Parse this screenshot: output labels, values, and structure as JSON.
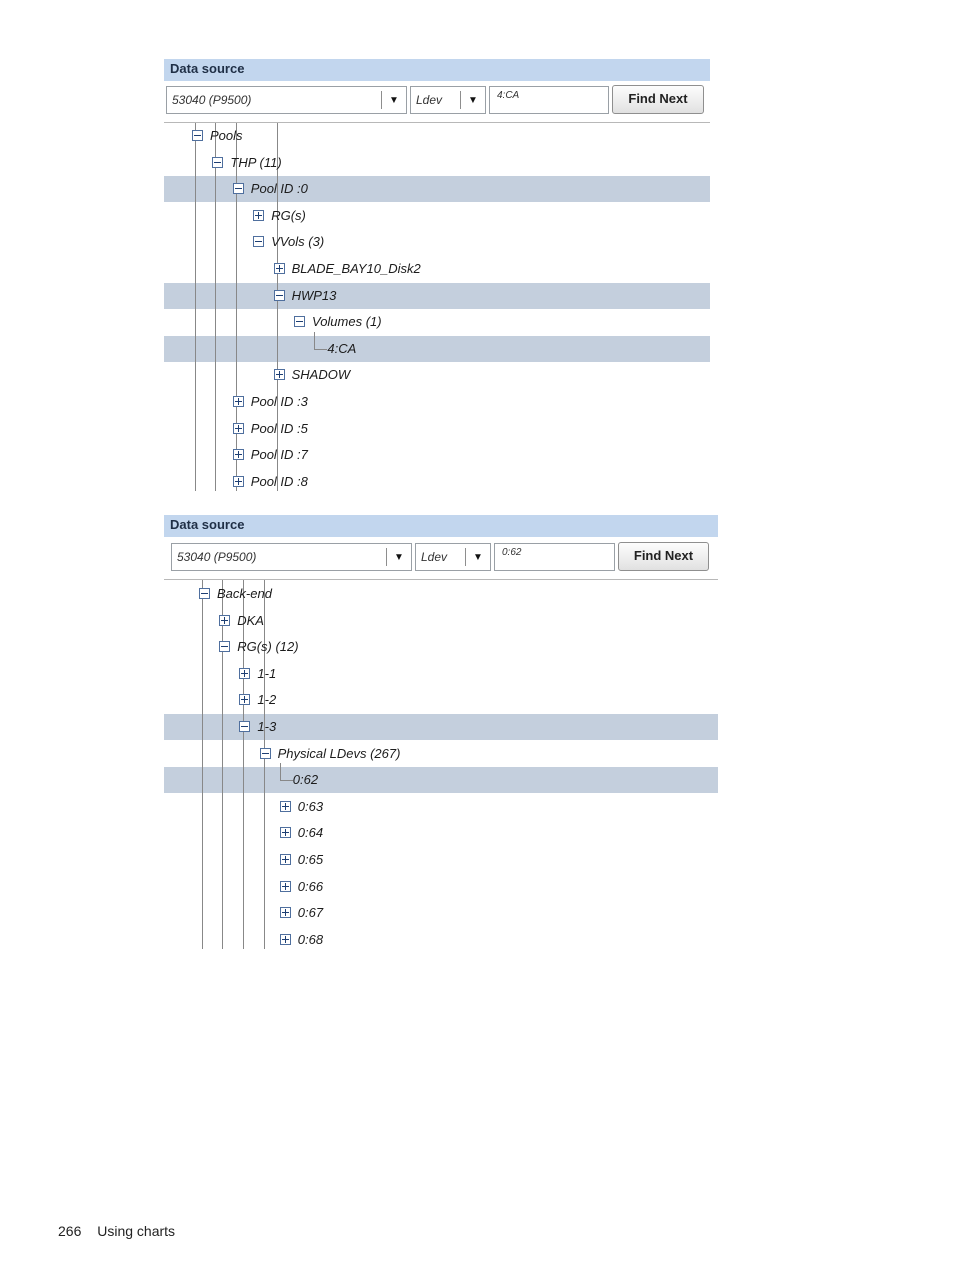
{
  "panels": [
    {
      "header": "Data source",
      "source_value": "53040  (P9500)",
      "type_value": "Ldev",
      "search_value": "4:CA",
      "find_next_label": "Find Next",
      "tree": [
        {
          "label": "Pools",
          "toggle": "minus",
          "depth": 0
        },
        {
          "label": "THP (11)",
          "toggle": "minus",
          "depth": 1
        },
        {
          "label": "Pool ID :0",
          "toggle": "minus",
          "depth": 2,
          "selected": true
        },
        {
          "label": "RG(s)",
          "toggle": "plus",
          "depth": 3
        },
        {
          "label": "VVols (3)",
          "toggle": "minus",
          "depth": 3
        },
        {
          "label": "BLADE_BAY10_Disk2",
          "toggle": "plus",
          "depth": 4
        },
        {
          "label": "HWP13",
          "toggle": "minus",
          "depth": 4,
          "selected": true
        },
        {
          "label": "Volumes (1)",
          "toggle": "minus",
          "depth": 5
        },
        {
          "label": "4:CA",
          "toggle": "leaf",
          "depth": 6,
          "selected": true
        },
        {
          "label": "SHADOW",
          "toggle": "plus",
          "depth": 4
        },
        {
          "label": "Pool ID :3",
          "toggle": "plus",
          "depth": 2
        },
        {
          "label": "Pool ID :5",
          "toggle": "plus",
          "depth": 2
        },
        {
          "label": "Pool ID :7",
          "toggle": "plus",
          "depth": 2
        },
        {
          "label": "Pool ID :8",
          "toggle": "plus",
          "depth": 2
        }
      ]
    },
    {
      "header": "Data source",
      "source_value": "53040  (P9500)",
      "type_value": "Ldev",
      "search_value": "0:62",
      "find_next_label": "Find Next",
      "tree": [
        {
          "label": "Back-end",
          "toggle": "minus",
          "depth": 0
        },
        {
          "label": "DKA",
          "toggle": "plus",
          "depth": 1
        },
        {
          "label": "RG(s) (12)",
          "toggle": "minus",
          "depth": 1
        },
        {
          "label": "1-1",
          "toggle": "plus",
          "depth": 2
        },
        {
          "label": "1-2",
          "toggle": "plus",
          "depth": 2
        },
        {
          "label": "1-3",
          "toggle": "minus",
          "depth": 2,
          "selected": true
        },
        {
          "label": "Physical LDevs (267)",
          "toggle": "minus",
          "depth": 3
        },
        {
          "label": "0:62",
          "toggle": "leaf",
          "depth": 4,
          "selected": true
        },
        {
          "label": "0:63",
          "toggle": "plus",
          "depth": 4
        },
        {
          "label": "0:64",
          "toggle": "plus",
          "depth": 4
        },
        {
          "label": "0:65",
          "toggle": "plus",
          "depth": 4
        },
        {
          "label": "0:66",
          "toggle": "plus",
          "depth": 4
        },
        {
          "label": "0:67",
          "toggle": "plus",
          "depth": 4
        },
        {
          "label": "0:68",
          "toggle": "plus",
          "depth": 4
        }
      ]
    }
  ],
  "footer": {
    "page_number": "266",
    "section": "Using charts"
  }
}
